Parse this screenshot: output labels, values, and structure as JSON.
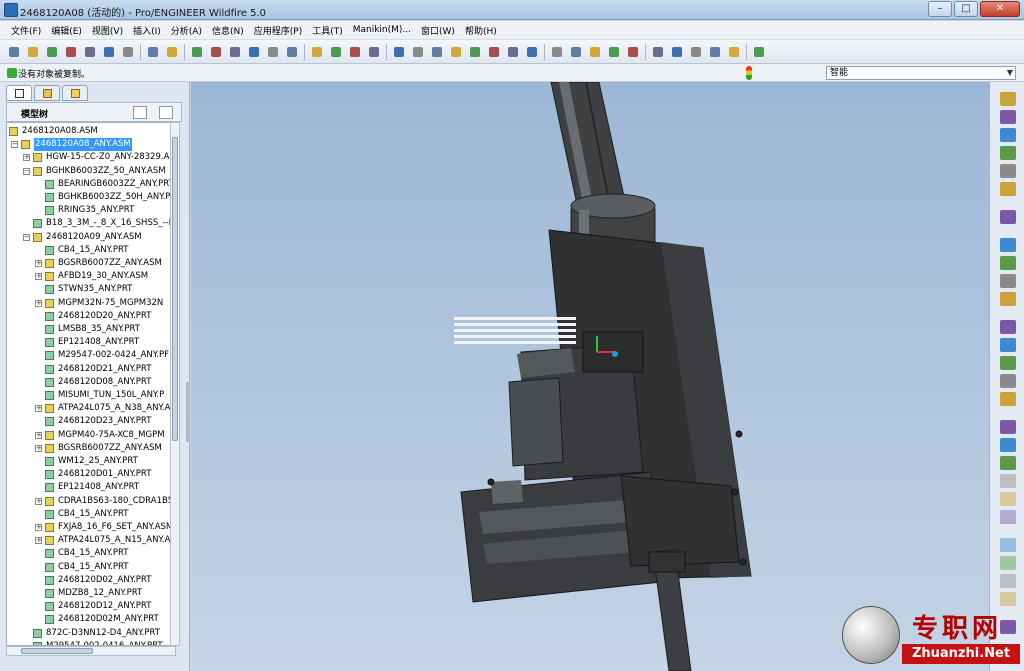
{
  "window": {
    "title": "2468120A08 (活动的) - Pro/ENGINEER Wildfire 5.0",
    "minimize_glyph": "–",
    "maximize_glyph": "□",
    "close_glyph": "✕"
  },
  "menu": [
    "文件(F)",
    "编辑(E)",
    "视图(V)",
    "插入(I)",
    "分析(A)",
    "信息(N)",
    "应用程序(P)",
    "工具(T)",
    "Manikin(M)...",
    "窗口(W)",
    "帮助(H)"
  ],
  "toolbar": {
    "icons": [
      "new-icon",
      "open-icon",
      "save-icon",
      "save-copy-icon",
      "print-icon",
      "email-icon",
      "mail-attach-icon",
      "undo-icon",
      "redo-icon",
      "cut-icon",
      "copy-icon",
      "paste-icon",
      "paste-special-icon",
      "regenerate-icon",
      "regen-manager-icon",
      "select-box-icon",
      "repaint-icon",
      "spin-center-icon",
      "appearance-icon",
      "orient-icon",
      "zoom-in-icon",
      "zoom-out-icon",
      "refit-icon",
      "reorient-icon",
      "saved-views-icon",
      "layers-icon",
      "view-manager-icon",
      "wireframe-icon",
      "hidden-line-icon",
      "no-hidden-icon",
      "shaded-icon",
      "enhanced-realism-icon",
      "datum-planes-icon",
      "datum-axes-icon",
      "datum-points-icon",
      "csys-icon",
      "annotation-icon",
      "context-help-icon"
    ]
  },
  "status": {
    "message": "没有对象被复制。",
    "filter_value": "智能"
  },
  "navigator": {
    "tabs": [
      "model-tree-tab-icon",
      "folder-browser-tab-icon",
      "favorites-tab-icon"
    ],
    "header_title": "模型树",
    "nodes": [
      {
        "label": "2468120A08.ASM",
        "type": "asm",
        "level": 0,
        "exp": ""
      },
      {
        "label": "2468120A08_ANY.ASM",
        "type": "asm",
        "level": 1,
        "exp": "−",
        "selected": true
      },
      {
        "label": "HGW-15-CC-Z0_ANY-28329.A",
        "type": "asm",
        "level": 2,
        "exp": "+"
      },
      {
        "label": "BGHKB6003ZZ_50_ANY.ASM",
        "type": "asm",
        "level": 2,
        "exp": "−"
      },
      {
        "label": "BEARINGB6003ZZ_ANY.PRT",
        "type": "prt",
        "level": 3,
        "exp": ""
      },
      {
        "label": "BGHKB6003ZZ_50H_ANY.P",
        "type": "prt",
        "level": 3,
        "exp": ""
      },
      {
        "label": "RRING35_ANY.PRT",
        "type": "prt",
        "level": 3,
        "exp": ""
      },
      {
        "label": "B18_3_3M_-_8_X_16_SHSS_--N",
        "type": "prt",
        "level": 2,
        "exp": ""
      },
      {
        "label": "2468120A09_ANY.ASM",
        "type": "asm",
        "level": 2,
        "exp": "−"
      },
      {
        "label": "CB4_15_ANY.PRT",
        "type": "prt",
        "level": 3,
        "exp": ""
      },
      {
        "label": "BGSRB6007ZZ_ANY.ASM",
        "type": "asm",
        "level": 3,
        "exp": "+"
      },
      {
        "label": "AFBD19_30_ANY.ASM",
        "type": "asm",
        "level": 3,
        "exp": "+"
      },
      {
        "label": "STWN35_ANY.PRT",
        "type": "prt",
        "level": 3,
        "exp": ""
      },
      {
        "label": "MGPM32N-75_MGPM32N",
        "type": "asm",
        "level": 3,
        "exp": "+"
      },
      {
        "label": "2468120D20_ANY.PRT",
        "type": "prt",
        "level": 3,
        "exp": ""
      },
      {
        "label": "LMSB8_35_ANY.PRT",
        "type": "prt",
        "level": 3,
        "exp": ""
      },
      {
        "label": "EP121408_ANY.PRT",
        "type": "prt",
        "level": 3,
        "exp": ""
      },
      {
        "label": "M29547-002-0424_ANY.PF",
        "type": "prt",
        "level": 3,
        "exp": ""
      },
      {
        "label": "2468120D21_ANY.PRT",
        "type": "prt",
        "level": 3,
        "exp": ""
      },
      {
        "label": "2468120D08_ANY.PRT",
        "type": "prt",
        "level": 3,
        "exp": ""
      },
      {
        "label": "MISUMI_TUN_150L_ANY.P",
        "type": "prt",
        "level": 3,
        "exp": ""
      },
      {
        "label": "ATPA24L075_A_N38_ANY.A",
        "type": "asm",
        "level": 3,
        "exp": "+"
      },
      {
        "label": "2468120D23_ANY.PRT",
        "type": "prt",
        "level": 3,
        "exp": ""
      },
      {
        "label": "MGPM40-75A-XC8_MGPM",
        "type": "asm",
        "level": 3,
        "exp": "+"
      },
      {
        "label": "BGSRB6007ZZ_ANY.ASM",
        "type": "asm",
        "level": 3,
        "exp": "+"
      },
      {
        "label": "WM12_25_ANY.PRT",
        "type": "prt",
        "level": 3,
        "exp": ""
      },
      {
        "label": "2468120D01_ANY.PRT",
        "type": "prt",
        "level": 3,
        "exp": ""
      },
      {
        "label": "EP121408_ANY.PRT",
        "type": "prt",
        "level": 3,
        "exp": ""
      },
      {
        "label": "CDRA1BS63-180_CDRA1B5",
        "type": "asm",
        "level": 3,
        "exp": "+"
      },
      {
        "label": "CB4_15_ANY.PRT",
        "type": "prt",
        "level": 3,
        "exp": ""
      },
      {
        "label": "FXJA8_16_F6_SET_ANY.ASM",
        "type": "asm",
        "level": 3,
        "exp": "+"
      },
      {
        "label": "ATPA24L075_A_N15_ANY.A",
        "type": "asm",
        "level": 3,
        "exp": "+"
      },
      {
        "label": "CB4_15_ANY.PRT",
        "type": "prt",
        "level": 3,
        "exp": ""
      },
      {
        "label": "CB4_15_ANY.PRT",
        "type": "prt",
        "level": 3,
        "exp": ""
      },
      {
        "label": "2468120D02_ANY.PRT",
        "type": "prt",
        "level": 3,
        "exp": ""
      },
      {
        "label": "MDZB8_12_ANY.PRT",
        "type": "prt",
        "level": 3,
        "exp": ""
      },
      {
        "label": "2468120D12_ANY.PRT",
        "type": "prt",
        "level": 3,
        "exp": ""
      },
      {
        "label": "2468120D02M_ANY.PRT",
        "type": "prt",
        "level": 3,
        "exp": ""
      },
      {
        "label": "872C-D3NN12-D4_ANY.PRT",
        "type": "prt",
        "level": 2,
        "exp": ""
      },
      {
        "label": "M29547-002-0416_ANY.PRT",
        "type": "prt",
        "level": 2,
        "exp": ""
      }
    ]
  },
  "right_toolbar": {
    "icons": [
      "sketch-icon",
      "plane-icon",
      "axis-icon",
      "curve-icon",
      "point-icon",
      "csys-datum-icon",
      "analysis-icon",
      "component-place-icon",
      "assemble-icon",
      "create-icon",
      "pattern-icon",
      "mirror-icon",
      "hole-icon",
      "round-icon",
      "chamfer-icon",
      "shell-icon",
      "draft-icon",
      "rib-icon",
      "extrude-icon",
      "revolve-icon",
      "sweep-icon",
      "blend-icon",
      "copy-feature-icon",
      "merge-icon",
      "intersect-icon",
      "trim-icon",
      "calculator-icon"
    ]
  },
  "watermark": {
    "cn": "专职网",
    "en": "Zhuanzhi.Net"
  },
  "colors": {
    "viewport_top": "#9cb7d6",
    "viewport_bottom": "#c5d4e6",
    "model": "#3b3d3f",
    "selection": "#3399ff",
    "watermark_red": "#c41212"
  }
}
